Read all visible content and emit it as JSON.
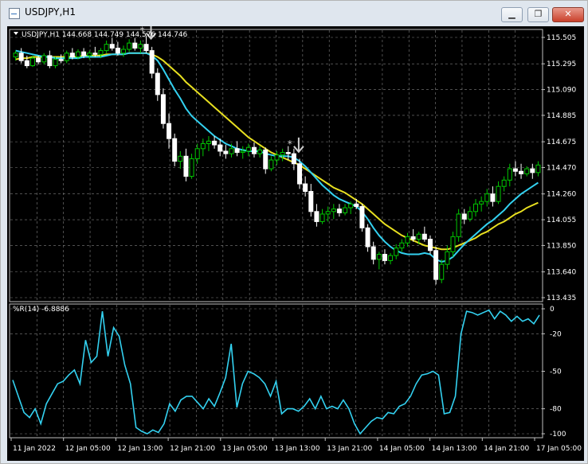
{
  "window": {
    "title": "USDJPY,H1",
    "minimize_label": "▁",
    "restore_label": "❐",
    "close_label": "✕"
  },
  "colors": {
    "background": "#000000",
    "grid": "#808080",
    "bull_candle": "#00c800",
    "bear_candle": "#ffffff",
    "fast_ma": "#33d1f0",
    "slow_ma": "#e8e020",
    "wpr_line": "#33d1f0",
    "axis_text": "#ffffff"
  },
  "chart_data": [
    {
      "type": "candlestick",
      "title": "USDJPY,H1",
      "info_line": "USDJPY,H1  144.668 144.749 144.576 144.746",
      "y_ticks": [
        "115.505",
        "115.295",
        "115.090",
        "114.885",
        "114.675",
        "114.470",
        "114.260",
        "114.055",
        "113.850",
        "113.640",
        "113.435"
      ],
      "ylim": [
        113.435,
        115.505
      ],
      "grid": true,
      "markers": [
        {
          "type": "sell-arrow",
          "near_candle": 23
        },
        {
          "type": "sell-arrow",
          "near_candle": 49
        }
      ],
      "candles": [
        [
          115.35,
          115.4,
          115.32,
          115.38
        ],
        [
          115.38,
          115.42,
          115.3,
          115.32
        ],
        [
          115.32,
          115.36,
          115.26,
          115.28
        ],
        [
          115.28,
          115.36,
          115.27,
          115.34
        ],
        [
          115.34,
          115.36,
          115.29,
          115.31
        ],
        [
          115.31,
          115.38,
          115.29,
          115.36
        ],
        [
          115.36,
          115.4,
          115.26,
          115.28
        ],
        [
          115.28,
          115.35,
          115.26,
          115.33
        ],
        [
          115.33,
          115.37,
          115.3,
          115.32
        ],
        [
          115.32,
          115.4,
          115.3,
          115.38
        ],
        [
          115.38,
          115.42,
          115.33,
          115.35
        ],
        [
          115.35,
          115.41,
          115.33,
          115.39
        ],
        [
          115.39,
          115.42,
          115.34,
          115.36
        ],
        [
          115.36,
          115.4,
          115.33,
          115.38
        ],
        [
          115.38,
          115.43,
          115.35,
          115.37
        ],
        [
          115.37,
          115.42,
          115.34,
          115.4
        ],
        [
          115.4,
          115.48,
          115.38,
          115.45
        ],
        [
          115.45,
          115.5,
          115.4,
          115.42
        ],
        [
          115.42,
          115.47,
          115.36,
          115.38
        ],
        [
          115.38,
          115.44,
          115.35,
          115.41
        ],
        [
          115.41,
          115.49,
          115.39,
          115.46
        ],
        [
          115.46,
          115.5,
          115.4,
          115.42
        ],
        [
          115.42,
          115.48,
          115.38,
          115.45
        ],
        [
          115.45,
          115.52,
          115.38,
          115.4
        ],
        [
          115.4,
          115.43,
          115.18,
          115.22
        ],
        [
          115.22,
          115.26,
          115.0,
          115.05
        ],
        [
          115.05,
          115.1,
          114.78,
          114.82
        ],
        [
          114.82,
          114.9,
          114.62,
          114.7
        ],
        [
          114.7,
          114.74,
          114.48,
          114.52
        ],
        [
          114.52,
          114.6,
          114.46,
          114.56
        ],
        [
          114.56,
          114.62,
          114.36,
          114.4
        ],
        [
          114.4,
          114.58,
          114.38,
          114.54
        ],
        [
          114.54,
          114.66,
          114.5,
          114.62
        ],
        [
          114.62,
          114.7,
          114.56,
          114.66
        ],
        [
          114.66,
          114.72,
          114.6,
          114.68
        ],
        [
          114.68,
          114.72,
          114.62,
          114.65
        ],
        [
          114.65,
          114.7,
          114.56,
          114.6
        ],
        [
          114.6,
          114.65,
          114.54,
          114.58
        ],
        [
          114.58,
          114.66,
          114.55,
          114.62
        ],
        [
          114.62,
          114.68,
          114.56,
          114.59
        ],
        [
          114.59,
          114.64,
          114.54,
          114.6
        ],
        [
          114.6,
          114.66,
          114.56,
          114.63
        ],
        [
          114.63,
          114.67,
          114.55,
          114.58
        ],
        [
          114.58,
          114.64,
          114.55,
          114.61
        ],
        [
          114.61,
          114.63,
          114.42,
          114.46
        ],
        [
          114.46,
          114.56,
          114.44,
          114.53
        ],
        [
          114.53,
          114.6,
          114.49,
          114.57
        ],
        [
          114.57,
          114.62,
          114.52,
          114.59
        ],
        [
          114.59,
          114.64,
          114.53,
          114.58
        ],
        [
          114.58,
          114.62,
          114.45,
          114.5
        ],
        [
          114.5,
          114.54,
          114.3,
          114.34
        ],
        [
          114.34,
          114.4,
          114.24,
          114.28
        ],
        [
          114.28,
          114.34,
          114.08,
          114.12
        ],
        [
          114.12,
          114.18,
          114.0,
          114.04
        ],
        [
          114.04,
          114.14,
          114.02,
          114.1
        ],
        [
          114.1,
          114.16,
          114.04,
          114.12
        ],
        [
          114.12,
          114.18,
          114.06,
          114.14
        ],
        [
          114.14,
          114.18,
          114.08,
          114.11
        ],
        [
          114.11,
          114.18,
          114.09,
          114.15
        ],
        [
          114.15,
          114.2,
          114.1,
          114.18
        ],
        [
          114.18,
          114.22,
          114.14,
          114.16
        ],
        [
          114.16,
          114.18,
          113.96,
          113.99
        ],
        [
          113.99,
          114.02,
          113.8,
          113.84
        ],
        [
          113.84,
          113.88,
          113.7,
          113.74
        ],
        [
          113.74,
          113.8,
          113.66,
          113.78
        ],
        [
          113.78,
          113.82,
          113.7,
          113.73
        ],
        [
          113.73,
          113.79,
          113.7,
          113.77
        ],
        [
          113.77,
          113.86,
          113.74,
          113.83
        ],
        [
          113.83,
          113.9,
          113.8,
          113.87
        ],
        [
          113.87,
          113.95,
          113.84,
          113.92
        ],
        [
          113.92,
          113.98,
          113.88,
          113.9
        ],
        [
          113.9,
          113.96,
          113.86,
          113.94
        ],
        [
          113.94,
          114.0,
          113.88,
          113.9
        ],
        [
          113.9,
          113.93,
          113.78,
          113.81
        ],
        [
          113.81,
          113.84,
          113.54,
          113.58
        ],
        [
          113.58,
          113.74,
          113.55,
          113.7
        ],
        [
          113.7,
          113.85,
          113.66,
          113.8
        ],
        [
          113.8,
          113.96,
          113.76,
          113.92
        ],
        [
          113.92,
          114.14,
          113.88,
          114.1
        ],
        [
          114.1,
          114.14,
          114.02,
          114.06
        ],
        [
          114.06,
          114.16,
          114.04,
          114.12
        ],
        [
          114.12,
          114.22,
          114.08,
          114.18
        ],
        [
          114.18,
          114.24,
          114.12,
          114.2
        ],
        [
          114.2,
          114.3,
          114.16,
          114.26
        ],
        [
          114.26,
          114.32,
          114.16,
          114.2
        ],
        [
          114.2,
          114.36,
          114.18,
          114.32
        ],
        [
          114.32,
          114.4,
          114.28,
          114.37
        ],
        [
          114.37,
          114.5,
          114.32,
          114.46
        ],
        [
          114.46,
          114.52,
          114.4,
          114.44
        ],
        [
          114.44,
          114.5,
          114.38,
          114.42
        ],
        [
          114.42,
          114.48,
          114.4,
          114.46
        ],
        [
          114.46,
          114.5,
          114.38,
          114.43
        ],
        [
          114.43,
          114.52,
          114.4,
          114.49
        ]
      ],
      "fast_ma": [
        115.4,
        115.39,
        115.38,
        115.37,
        115.36,
        115.35,
        115.35,
        115.34,
        115.34,
        115.34,
        115.34,
        115.34,
        115.35,
        115.35,
        115.35,
        115.35,
        115.36,
        115.37,
        115.37,
        115.37,
        115.38,
        115.38,
        115.38,
        115.38,
        115.36,
        115.32,
        115.25,
        115.17,
        115.09,
        115.02,
        114.94,
        114.88,
        114.84,
        114.8,
        114.76,
        114.72,
        114.69,
        114.66,
        114.64,
        114.62,
        114.61,
        114.6,
        114.6,
        114.6,
        114.58,
        114.57,
        114.56,
        114.56,
        114.56,
        114.55,
        114.52,
        114.48,
        114.43,
        114.38,
        114.33,
        114.29,
        114.25,
        114.22,
        114.2,
        114.18,
        114.16,
        114.12,
        114.06,
        113.99,
        113.93,
        113.88,
        113.84,
        113.81,
        113.79,
        113.78,
        113.78,
        113.78,
        113.79,
        113.78,
        113.74,
        113.72,
        113.73,
        113.76,
        113.81,
        113.86,
        113.9,
        113.94,
        113.98,
        114.02,
        114.05,
        114.09,
        114.13,
        114.18,
        114.22,
        114.26,
        114.29,
        114.32,
        114.35
      ],
      "slow_ma": [
        115.33,
        115.34,
        115.34,
        115.35,
        115.35,
        115.35,
        115.35,
        115.35,
        115.35,
        115.35,
        115.35,
        115.35,
        115.36,
        115.36,
        115.36,
        115.36,
        115.37,
        115.37,
        115.37,
        115.37,
        115.38,
        115.38,
        115.38,
        115.38,
        115.37,
        115.35,
        115.32,
        115.28,
        115.24,
        115.2,
        115.15,
        115.11,
        115.07,
        115.03,
        114.99,
        114.95,
        114.91,
        114.87,
        114.83,
        114.79,
        114.75,
        114.71,
        114.68,
        114.65,
        114.62,
        114.59,
        114.57,
        114.55,
        114.53,
        114.51,
        114.49,
        114.46,
        114.43,
        114.4,
        114.37,
        114.34,
        114.31,
        114.29,
        114.27,
        114.24,
        114.21,
        114.18,
        114.14,
        114.1,
        114.06,
        114.02,
        113.99,
        113.96,
        113.93,
        113.91,
        113.89,
        113.87,
        113.85,
        113.84,
        113.83,
        113.82,
        113.82,
        113.83,
        113.85,
        113.87,
        113.89,
        113.91,
        113.94,
        113.96,
        113.99,
        114.02,
        114.04,
        114.07,
        114.1,
        114.12,
        114.15,
        114.17,
        114.19
      ]
    },
    {
      "type": "line",
      "title": "%R(14) -6.8886",
      "y_ticks": [
        "0",
        "-20",
        "-50",
        "-80",
        "-100"
      ],
      "ylim": [
        -100,
        0
      ],
      "grid": true,
      "x_ticks": [
        "11 Jan 2022",
        "12 Jan 05:00",
        "12 Jan 13:00",
        "12 Jan 21:00",
        "13 Jan 05:00",
        "13 Jan 13:00",
        "13 Jan 21:00",
        "14 Jan 05:00",
        "14 Jan 13:00",
        "14 Jan 21:00",
        "17 Jan 05:00"
      ],
      "values": [
        -57,
        -70,
        -83,
        -87,
        -80,
        -92,
        -76,
        -68,
        -60,
        -58,
        -53,
        -49,
        -60,
        -25,
        -43,
        -38,
        -2,
        -38,
        -15,
        -22,
        -45,
        -60,
        -95,
        -98,
        -100,
        -97,
        -99,
        -92,
        -76,
        -82,
        -73,
        -70,
        -70,
        -75,
        -80,
        -72,
        -78,
        -67,
        -55,
        -28,
        -79,
        -60,
        -50,
        -52,
        -55,
        -60,
        -70,
        -58,
        -84,
        -80,
        -80,
        -82,
        -78,
        -72,
        -80,
        -70,
        -80,
        -78,
        -80,
        -73,
        -80,
        -92,
        -100,
        -95,
        -90,
        -87,
        -88,
        -83,
        -84,
        -78,
        -76,
        -70,
        -60,
        -53,
        -52,
        -50,
        -53,
        -84,
        -83,
        -70,
        -20,
        -2,
        -3,
        -5,
        -3,
        -1,
        -8,
        -2,
        -5,
        -10,
        -6,
        -10,
        -8,
        -12,
        -5
      ]
    }
  ]
}
